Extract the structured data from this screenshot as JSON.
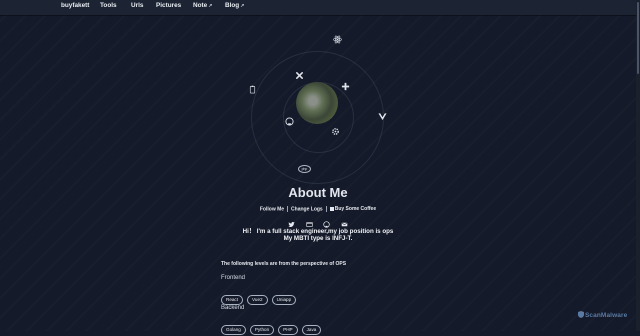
{
  "nav": {
    "items": [
      {
        "label": "buyfakett",
        "ext": ""
      },
      {
        "label": "Tools",
        "ext": ""
      },
      {
        "label": "Urls",
        "ext": ""
      },
      {
        "label": "Pictures",
        "ext": ""
      },
      {
        "label": "Note",
        "ext": "↗"
      },
      {
        "label": "Blog",
        "ext": "↗"
      }
    ]
  },
  "orbit": {
    "icons": [
      "react-icon",
      "tools-cross-icon",
      "plus-gear-icon",
      "clipboard-icon",
      "vue-icon",
      "github-icon",
      "cog-icon",
      "php-icon"
    ],
    "php_label": "php"
  },
  "about": {
    "title": "About Me",
    "links": [
      "Follow Me",
      "Change Logs",
      "Buy Some Coffee"
    ],
    "social_icons": [
      "twitter-icon",
      "mail-open-icon",
      "github-icon",
      "email-icon"
    ],
    "intro_line1": "Hi！ I'm a full stack engineer,my job position is ops",
    "intro_line2": "My MBTI type is INFJ-T.",
    "perspective": "The following levels are from the perspective of OPS"
  },
  "skills": {
    "frontend_title": "Frontend",
    "frontend": [
      "React",
      "Vue2",
      "Uniapp"
    ],
    "backend_title": "Backend",
    "backend": [
      "Golang",
      "Python",
      "PHP",
      "Java"
    ]
  },
  "watermark": "ScanMalware",
  "colors": {
    "background": "#141a29",
    "navbar": "#1c2433",
    "text": "#e6e9ef",
    "watermark": "#5a7aa3"
  }
}
